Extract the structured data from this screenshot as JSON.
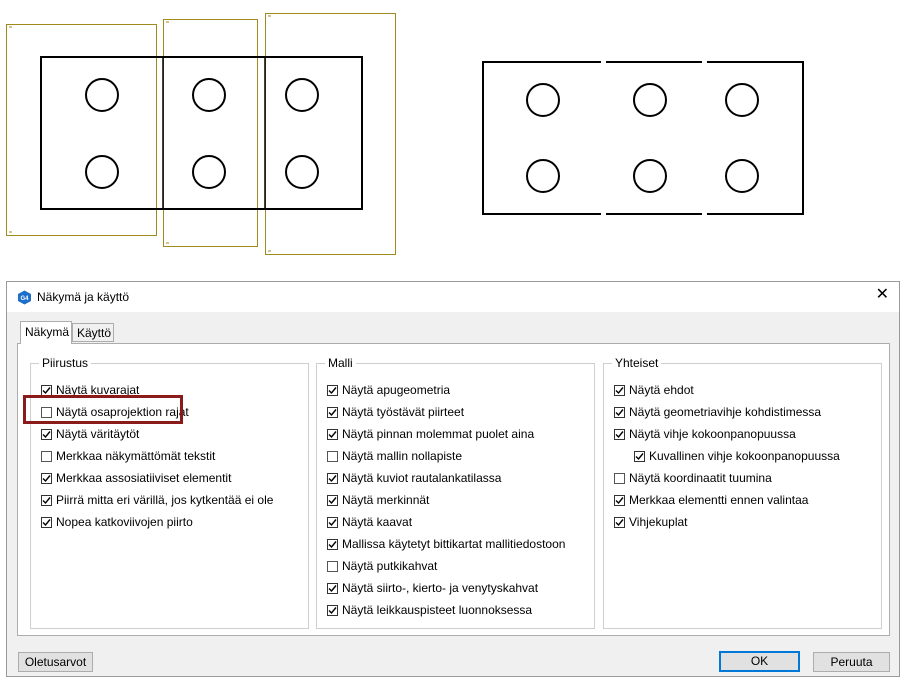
{
  "dialog": {
    "title": "Näkymä ja käyttö",
    "icon_text": "G4",
    "close_glyph": "✕",
    "tabs": [
      {
        "label": "Näkymä",
        "active": true
      },
      {
        "label": "Käyttö",
        "active": false
      }
    ],
    "groups": {
      "piirustus": {
        "title": "Piirustus",
        "items": [
          {
            "label": "Näytä kuvarajat",
            "checked": true
          },
          {
            "label": "Näytä osaprojektion rajat",
            "checked": false,
            "highlighted": true
          },
          {
            "label": "Näytä väritäytöt",
            "checked": true
          },
          {
            "label": "Merkkaa näkymättömät tekstit",
            "checked": false
          },
          {
            "label": "Merkkaa assosiatiiviset elementit",
            "checked": true
          },
          {
            "label": "Piirrä mitta eri värillä, jos kytkentää ei ole",
            "checked": true
          },
          {
            "label": "Nopea katkoviivojen piirto",
            "checked": true
          }
        ]
      },
      "malli": {
        "title": "Malli",
        "items": [
          {
            "label": "Näytä apugeometria",
            "checked": true
          },
          {
            "label": "Näytä työstävät piirteet",
            "checked": true
          },
          {
            "label": "Näytä pinnan molemmat puolet aina",
            "checked": true
          },
          {
            "label": "Näytä mallin nollapiste",
            "checked": false
          },
          {
            "label": "Näytä kuviot rautalankatilassa",
            "checked": true
          },
          {
            "label": "Näytä merkinnät",
            "checked": true
          },
          {
            "label": "Näytä kaavat",
            "checked": true
          },
          {
            "label": "Mallissa käytetyt bittikartat mallitiedostoon",
            "checked": true
          },
          {
            "label": "Näytä putkikahvat",
            "checked": false
          },
          {
            "label": "Näytä siirto-, kierto- ja venytyskahvat",
            "checked": true
          },
          {
            "label": "Näytä leikkauspisteet luonnoksessa",
            "checked": true
          }
        ]
      },
      "yhteiset": {
        "title": "Yhteiset",
        "items": [
          {
            "label": "Näytä ehdot",
            "checked": true
          },
          {
            "label": "Näytä geometriavihje kohdistimessa",
            "checked": true
          },
          {
            "label": "Näytä vihje kokoonpanopuussa",
            "checked": true
          },
          {
            "label": "Kuvallinen vihje kokoonpanopuussa",
            "checked": true,
            "indent": true
          },
          {
            "label": "Näytä koordinaatit tuumina",
            "checked": false
          },
          {
            "label": "Merkkaa elementti ennen valintaa",
            "checked": true
          },
          {
            "label": "Vihjekuplat",
            "checked": true
          }
        ]
      }
    },
    "buttons": {
      "defaults": "Oletusarvot",
      "ok": "OK",
      "cancel": "Peruuta"
    }
  },
  "colors": {
    "frame_yellow": "#a08a1e",
    "highlight_red": "#8b1a1a",
    "accent_blue": "#0078d7",
    "icon_blue": "#1e6fc9"
  }
}
